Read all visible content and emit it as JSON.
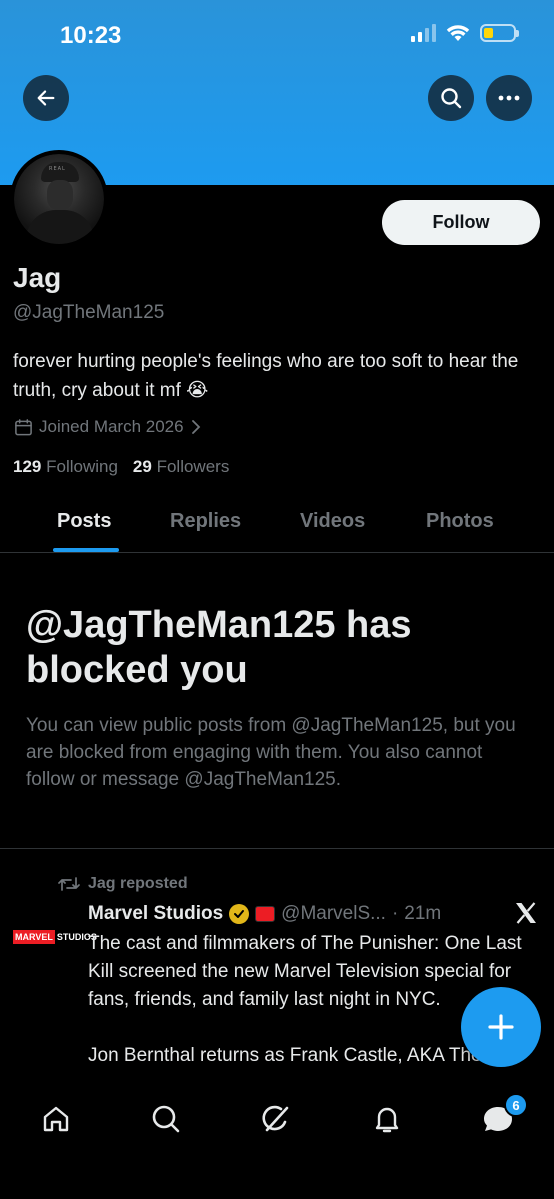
{
  "status_bar": {
    "time": "10:23"
  },
  "profile": {
    "name": "Jag",
    "handle": "@JagTheMan125",
    "bio": "forever hurting people's feelings who are too soft to hear the truth, cry about it mf 😭",
    "joined": "Joined March 2026",
    "following_count": "129",
    "following_label": "Following",
    "followers_count": "29",
    "followers_label": "Followers",
    "follow_label": "Follow",
    "avatar_cap_text": "REAL"
  },
  "tabs": [
    {
      "label": "Posts",
      "active": true
    },
    {
      "label": "Replies",
      "active": false
    },
    {
      "label": "Videos",
      "active": false
    },
    {
      "label": "Photos",
      "active": false
    }
  ],
  "blocked": {
    "title": "@JagTheMan125 has blocked you",
    "description": "You can view public posts from @JagTheMan125, but you are blocked from engaging with them. You also cannot follow or message @JagTheMan125."
  },
  "post": {
    "repost_label": "Jag reposted",
    "author": "Marvel Studios",
    "author_handle": "@MarvelS...",
    "separator": "·",
    "time": "21m",
    "logo_text_1": "MARVEL",
    "logo_text_2": "STUDIOS",
    "text": "The cast and filmmakers of The Punisher: One Last Kill screened the new Marvel Television special for fans, friends, and family last night in NYC.\n\nJon Bernthal returns as Frank Castle, AKA The"
  },
  "nav": {
    "messages_badge": "6"
  },
  "colors": {
    "accent": "#1d9bf0",
    "background": "#000000",
    "muted": "#71767b",
    "text": "#e7e9ea"
  },
  "icons": [
    "back-arrow-icon",
    "search-icon",
    "more-icon",
    "calendar-icon",
    "chevron-right-icon",
    "repost-icon",
    "verified-icon",
    "x-logo-icon",
    "plus-icon",
    "home-icon",
    "explore-icon",
    "grok-icon",
    "bell-icon",
    "messages-icon"
  ]
}
